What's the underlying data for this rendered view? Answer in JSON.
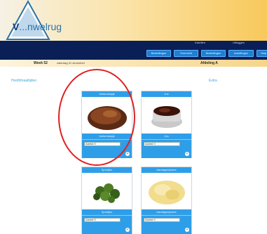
{
  "header": {
    "logo_prefix": "V",
    "logo_text": "...nwelrug"
  },
  "nav": {
    "top_links": [
      "Instellen",
      "Uitloggen"
    ],
    "buttons": [
      "Bestellingen",
      "Overzicht",
      "Bestellingen",
      "Instellingen",
      "Help"
    ]
  },
  "week": {
    "label": "Week 52",
    "date": "zaterdag 31 december",
    "department": "Afdeling A"
  },
  "sections": {
    "main": "Hoofdmaaltijden",
    "extra": "Extra"
  },
  "products": [
    {
      "header": "Varkenslapje",
      "name": "Varkenslapje",
      "qty": "Aantal 0",
      "plus": "+"
    },
    {
      "header": "Jus",
      "name": "Jus",
      "qty": "Aantal 0",
      "plus": "+"
    },
    {
      "header": "Spruitjes",
      "name": "Spruitjes",
      "qty": "Aantal 0",
      "plus": "+"
    },
    {
      "header": "Aardappelpuree",
      "name": "Aardappelpuree",
      "qty": "Aantal 0",
      "plus": "+"
    }
  ],
  "colors": {
    "nav_bg": "#0a1f56",
    "card_accent": "#2f9ee8",
    "highlight": "#e02020"
  }
}
